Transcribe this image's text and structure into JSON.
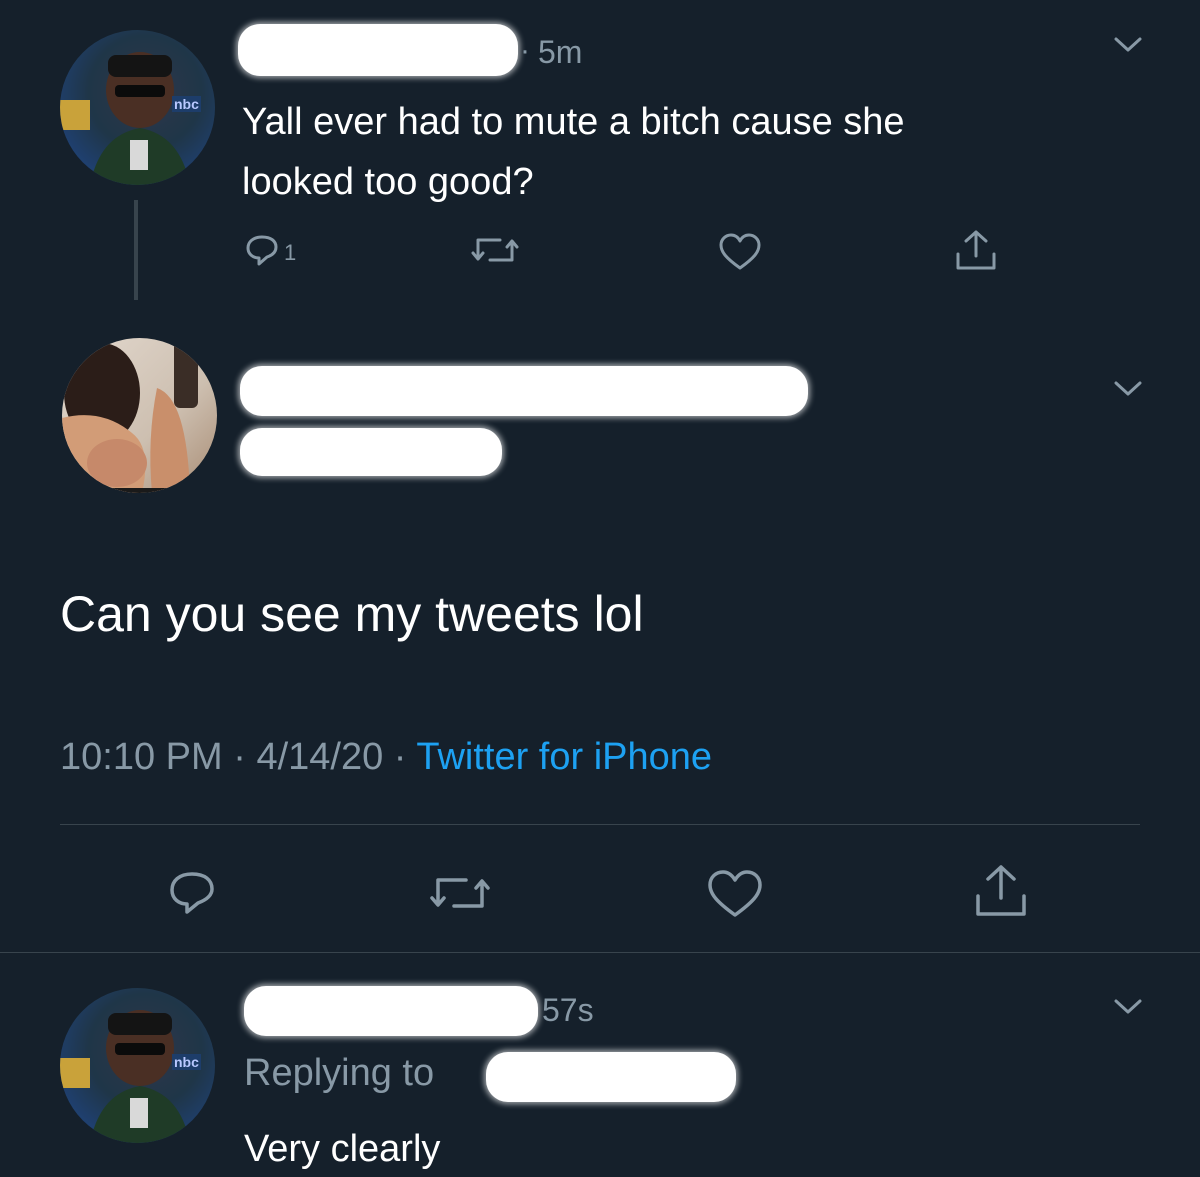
{
  "tweet1": {
    "time": "5m",
    "text_line1": "Yall ever had to mute a bitch cause she",
    "text_line2": "looked too good?",
    "reply_count": "1",
    "avatar_badge": "nbc"
  },
  "tweet2": {
    "text": "Can you see my tweets lol",
    "timestamp": "10:10 PM",
    "date": "4/14/20",
    "source": "Twitter for iPhone",
    "separator": "·"
  },
  "tweet3": {
    "time": "57s",
    "replying_to_label": "Replying to",
    "text": "Very clearly",
    "avatar_badge": "nbc"
  },
  "colors": {
    "background": "#15202b",
    "text": "#ffffff",
    "muted": "#8899a6",
    "link": "#1da1f2",
    "divider": "#38444d"
  },
  "icons": [
    "reply-icon",
    "retweet-icon",
    "like-icon",
    "share-icon",
    "chevron-down-icon"
  ]
}
